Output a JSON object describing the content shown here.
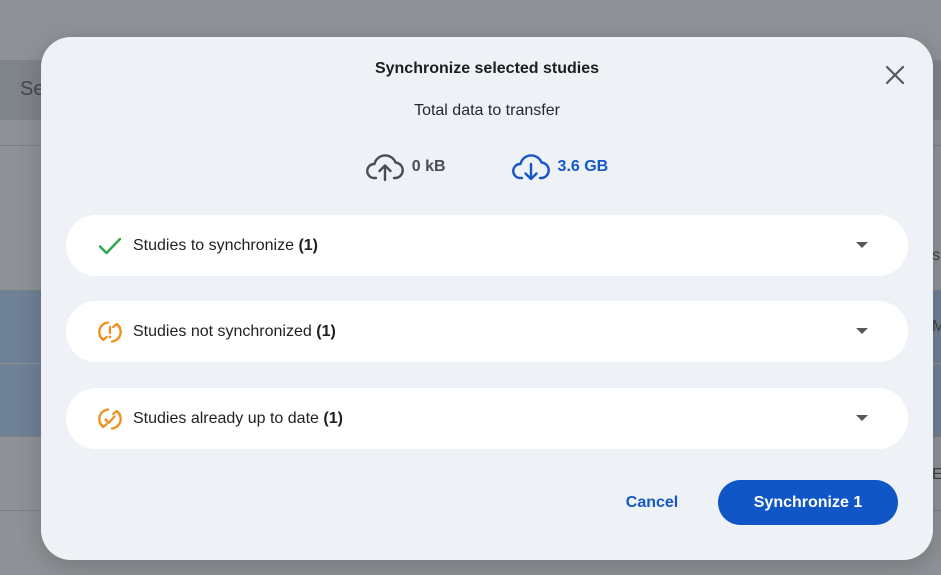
{
  "background": {
    "header_text": "Se",
    "edge_chars": [
      "s",
      "M",
      "E"
    ]
  },
  "dialog": {
    "title": "Synchronize selected studies",
    "subtitle": "Total data to transfer",
    "upload": {
      "icon": "cloud-upload-icon",
      "amount": "0 kB"
    },
    "download": {
      "icon": "cloud-download-icon",
      "amount": "3.6 GB",
      "color": "#1458c7"
    },
    "sections": [
      {
        "icon": "check-icon",
        "label": "Studies to synchronize",
        "count": "(1)",
        "icon_color": "#2ea84a"
      },
      {
        "icon": "sync-alert-icon",
        "label": "Studies not synchronized",
        "count": "(1)",
        "icon_color": "#f0901e"
      },
      {
        "icon": "sync-check-icon",
        "label": "Studies already up to date",
        "count": "(1)",
        "icon_color": "#f0901e"
      }
    ],
    "buttons": {
      "cancel_label": "Cancel",
      "synchronize_label": "Synchronize 1",
      "primary_color": "#1156c6"
    }
  }
}
